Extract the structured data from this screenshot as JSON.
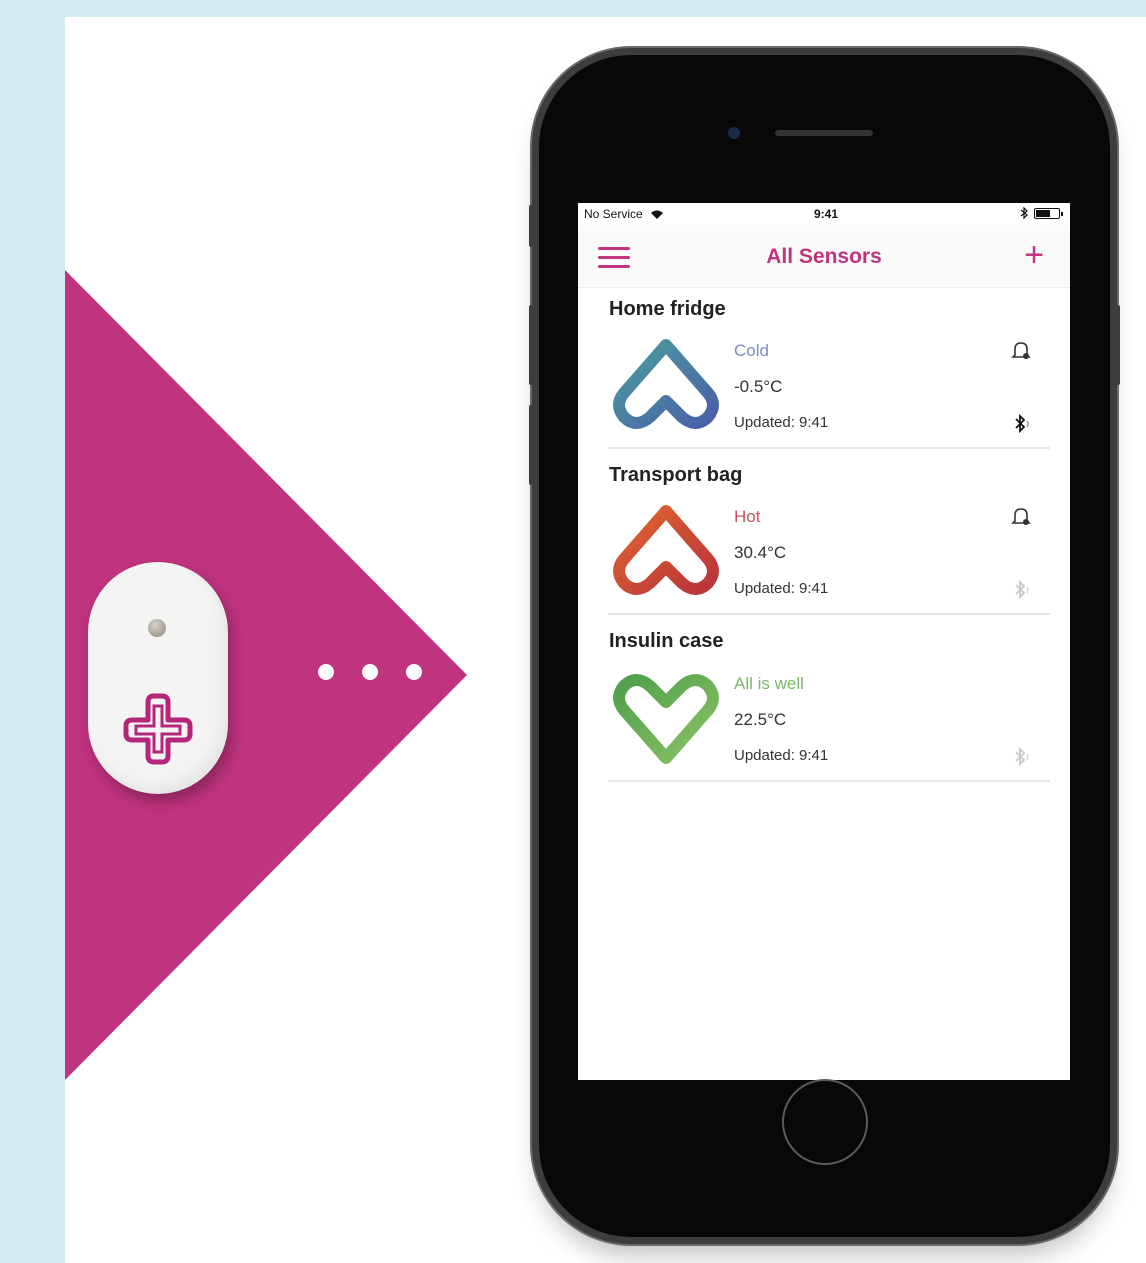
{
  "colors": {
    "frame": "#d3edf2",
    "magenta": "#c0337f",
    "cold_status": "#7c8fc4",
    "hot_status": "#c9535e",
    "well_status": "#7ab86a"
  },
  "device": {
    "logo_icon": "medical-cross-icon",
    "indicator_dots": 3
  },
  "phone": {
    "statusbar": {
      "carrier": "No Service",
      "time": "9:41"
    },
    "navbar": {
      "menu_icon": "hamburger-menu-icon",
      "title": "All Sensors",
      "add_label": "+"
    },
    "sensors": [
      {
        "name": "Home fridge",
        "status": "Cold",
        "temperature": "-0.5°C",
        "updated": "Updated: 9:41",
        "icon": "chevron-up-heart-icon",
        "has_bell": true,
        "bluetooth_active": true
      },
      {
        "name": "Transport bag",
        "status": "Hot",
        "temperature": "30.4°C",
        "updated": "Updated: 9:41",
        "icon": "chevron-up-heart-icon",
        "has_bell": true,
        "bluetooth_active": false
      },
      {
        "name": "Insulin case",
        "status": "All is well",
        "temperature": "22.5°C",
        "updated": "Updated: 9:41",
        "icon": "heart-icon",
        "has_bell": false,
        "bluetooth_active": false
      }
    ]
  }
}
